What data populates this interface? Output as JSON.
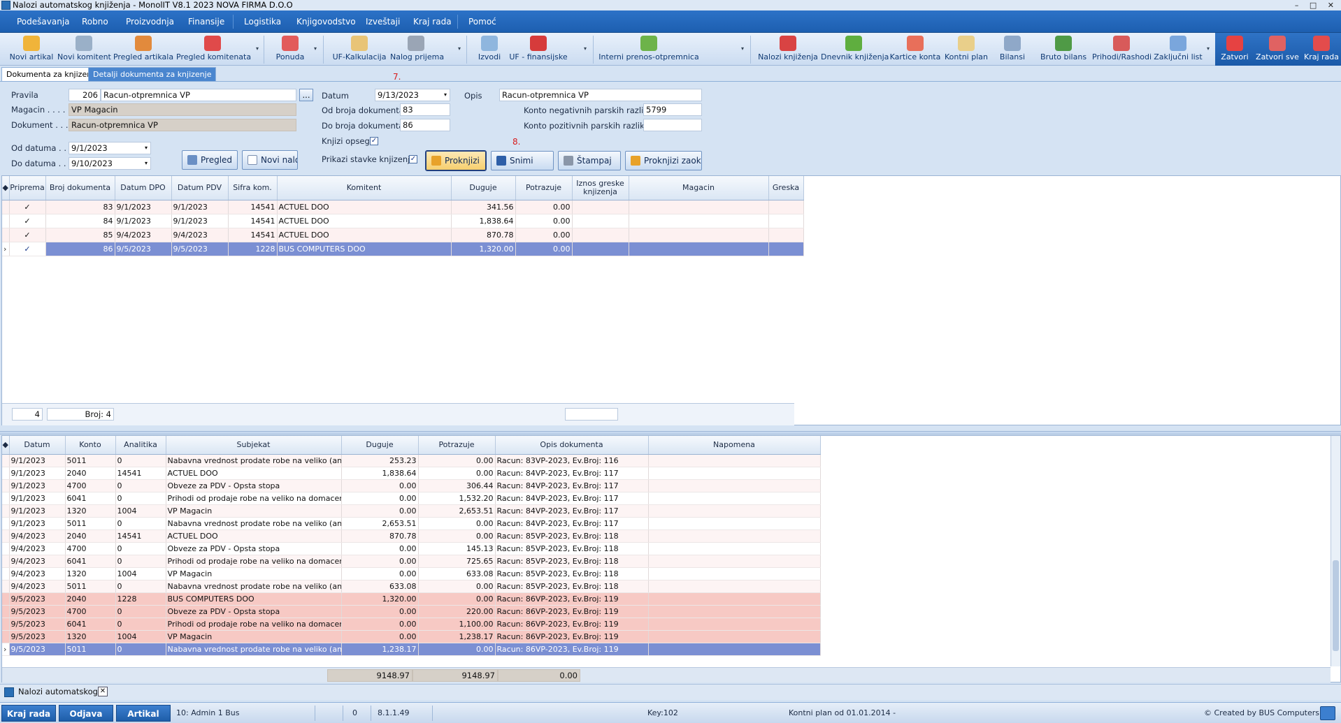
{
  "window": {
    "title": "Nalozi automatskog knjiženja - MonolIT V8.1 2023 NOVA FIRMA D.O.O",
    "controls": "– □ ✕"
  },
  "menu": [
    "Podešavanja",
    "Robno",
    "Proizvodnja",
    "Finansije",
    "Logistika",
    "Knjigovodstvo",
    "Izveštaji",
    "Kraj rada",
    "Pomoć"
  ],
  "ribbon": {
    "left": [
      {
        "label": "Novi artikal",
        "color": "#f0b43a"
      },
      {
        "label": "Novi komitent",
        "color": "#9ab0c8"
      },
      {
        "label": "Pregled artikala",
        "color": "#e28a3c"
      },
      {
        "label": "Pregled komitenata",
        "color": "#e04a4a"
      },
      {
        "label": "Ponuda",
        "color": "#e25b5b"
      },
      {
        "label": "UF-Kalkulacija",
        "color": "#e8c477"
      },
      {
        "label": "Nalog prijema",
        "color": "#9aa5b5"
      },
      {
        "label": "Izvodi",
        "color": "#8fb6de"
      },
      {
        "label": "UF - finansijske",
        "color": "#d63b3b"
      },
      {
        "label": "Interni prenos-otpremnica",
        "color": "#6db34a"
      },
      {
        "label": "Nalozi knjiženja",
        "color": "#d94343"
      },
      {
        "label": "Dnevnik knjiženja",
        "color": "#5fae3f"
      },
      {
        "label": "Kartice konta",
        "color": "#e86f5a"
      },
      {
        "label": "Kontni plan",
        "color": "#e9cf8a"
      },
      {
        "label": "Bilansi",
        "color": "#8fa8c8"
      },
      {
        "label": "Bruto bilans",
        "color": "#4f9a46"
      },
      {
        "label": "Prihodi/Rashodi",
        "color": "#d85a5a"
      },
      {
        "label": "Zaključni list",
        "color": "#7aa6dc"
      }
    ],
    "right": [
      {
        "label": "Zatvori",
        "color": "#e64242"
      },
      {
        "label": "Zatvori sve",
        "color": "#e06262"
      },
      {
        "label": "Kraj rada",
        "color": "#e34c4c"
      }
    ]
  },
  "tabs": [
    "Dokumenta za knjizenje",
    "Detalji dokumenta za knjizenje"
  ],
  "form": {
    "pravila_label": "Pravila",
    "pravila_code": "206",
    "pravila_name": "Racun-otpremnica VP",
    "dots": "...",
    "magacin_label": "Magacin . . . . .",
    "magacin_value": "VP Magacin",
    "dokument_label": "Dokument . . .",
    "dokument_value": "Racun-otpremnica VP",
    "od_datuma_label": "Od datuma . . .",
    "od_datuma": "9/1/2023",
    "do_datuma_label": "Do datuma . . . .",
    "do_datuma": "9/10/2023",
    "datum_label": "Datum",
    "datum": "9/13/2023",
    "od_broja_label": "Od broja dokumenta",
    "od_broja": "83",
    "do_broja_label": "Do broja dokumenta",
    "do_broja": "86",
    "knjizi_opseg_label": "Knjizi opseg",
    "prikazi_label": "Prikazi stavke knjizenja",
    "opis_label": "Opis",
    "opis": "Racun-otpremnica VP",
    "konto_neg_label": "Konto negativnih parskih razlika",
    "konto_neg": "5799",
    "konto_poz_label": "Konto pozitivnih parskih razlika",
    "konto_poz": "",
    "marker7": "7.",
    "marker8": "8."
  },
  "buttons": {
    "pregled": "Pregled",
    "novi_nalog": "Novi nalog",
    "proknjizi": "Proknjizi",
    "snimi": "Snimi",
    "stampaj": "Štampaj",
    "proknjizi_zak": "Proknjizi zaokruživanje"
  },
  "grid1": {
    "headers": [
      "Priprema",
      "Broj dokumenta",
      "Datum DPO",
      "Datum PDV",
      "Sifra kom.",
      "Komitent",
      "Duguje",
      "Potrazuje",
      "Iznos greske knjizenja",
      "Magacin",
      "Greska"
    ],
    "rows": [
      {
        "checked": "✓",
        "broj": "83",
        "dpo": "9/1/2023",
        "pdv": "9/1/2023",
        "sifra": "14541",
        "komitent": "ACTUEL DOO",
        "duguje": "341.56",
        "potrazuje": "0.00"
      },
      {
        "checked": "✓",
        "broj": "84",
        "dpo": "9/1/2023",
        "pdv": "9/1/2023",
        "sifra": "14541",
        "komitent": "ACTUEL DOO",
        "duguje": "1,838.64",
        "potrazuje": "0.00"
      },
      {
        "checked": "✓",
        "broj": "85",
        "dpo": "9/4/2023",
        "pdv": "9/4/2023",
        "sifra": "14541",
        "komitent": "ACTUEL DOO",
        "duguje": "870.78",
        "potrazuje": "0.00"
      },
      {
        "checked": "✓",
        "broj": "86",
        "dpo": "9/5/2023",
        "pdv": "9/5/2023",
        "sifra": "1228",
        "komitent": "BUS COMPUTERS DOO",
        "duguje": "1,320.00",
        "potrazuje": "0.00"
      }
    ],
    "footer_count": "4",
    "footer_broj": "Broj: 4"
  },
  "grid2": {
    "headers": [
      "Datum",
      "Konto",
      "Analitika",
      "Subjekat",
      "Duguje",
      "Potrazuje",
      "Opis dokumenta",
      "Napomena"
    ],
    "rows": [
      {
        "datum": "9/1/2023",
        "konto": "5011",
        "analitika": "0",
        "subjekat": "Nabavna vrednost prodate robe na veliko (analitika",
        "duguje": "253.23",
        "potrazuje": "0.00",
        "opis": "Racun: 83VP-2023, Ev.Broj: 116"
      },
      {
        "datum": "9/1/2023",
        "konto": "2040",
        "analitika": "14541",
        "subjekat": "ACTUEL DOO",
        "duguje": "1,838.64",
        "potrazuje": "0.00",
        "opis": "Racun: 84VP-2023, Ev.Broj: 117"
      },
      {
        "datum": "9/1/2023",
        "konto": "4700",
        "analitika": "0",
        "subjekat": "Obveze za PDV - Opsta stopa",
        "duguje": "0.00",
        "potrazuje": "306.44",
        "opis": "Racun: 84VP-2023, Ev.Broj: 117"
      },
      {
        "datum": "9/1/2023",
        "konto": "6041",
        "analitika": "0",
        "subjekat": "Prihodi od prodaje robe na veliko na domacem trzist",
        "duguje": "0.00",
        "potrazuje": "1,532.20",
        "opis": "Racun: 84VP-2023, Ev.Broj: 117"
      },
      {
        "datum": "9/1/2023",
        "konto": "1320",
        "analitika": "1004",
        "subjekat": "VP Magacin",
        "duguje": "0.00",
        "potrazuje": "2,653.51",
        "opis": "Racun: 84VP-2023, Ev.Broj: 117"
      },
      {
        "datum": "9/1/2023",
        "konto": "5011",
        "analitika": "0",
        "subjekat": "Nabavna vrednost prodate robe na veliko (analitika",
        "duguje": "2,653.51",
        "potrazuje": "0.00",
        "opis": "Racun: 84VP-2023, Ev.Broj: 117"
      },
      {
        "datum": "9/4/2023",
        "konto": "2040",
        "analitika": "14541",
        "subjekat": "ACTUEL DOO",
        "duguje": "870.78",
        "potrazuje": "0.00",
        "opis": "Racun: 85VP-2023, Ev.Broj: 118"
      },
      {
        "datum": "9/4/2023",
        "konto": "4700",
        "analitika": "0",
        "subjekat": "Obveze za PDV - Opsta stopa",
        "duguje": "0.00",
        "potrazuje": "145.13",
        "opis": "Racun: 85VP-2023, Ev.Broj: 118"
      },
      {
        "datum": "9/4/2023",
        "konto": "6041",
        "analitika": "0",
        "subjekat": "Prihodi od prodaje robe na veliko na domacem trzist",
        "duguje": "0.00",
        "potrazuje": "725.65",
        "opis": "Racun: 85VP-2023, Ev.Broj: 118"
      },
      {
        "datum": "9/4/2023",
        "konto": "1320",
        "analitika": "1004",
        "subjekat": "VP Magacin",
        "duguje": "0.00",
        "potrazuje": "633.08",
        "opis": "Racun: 85VP-2023, Ev.Broj: 118"
      },
      {
        "datum": "9/4/2023",
        "konto": "5011",
        "analitika": "0",
        "subjekat": "Nabavna vrednost prodate robe na veliko (analitika",
        "duguje": "633.08",
        "potrazuje": "0.00",
        "opis": "Racun: 85VP-2023, Ev.Broj: 118"
      },
      {
        "datum": "9/5/2023",
        "konto": "2040",
        "analitika": "1228",
        "subjekat": "BUS COMPUTERS DOO",
        "duguje": "1,320.00",
        "potrazuje": "0.00",
        "opis": "Racun: 86VP-2023, Ev.Broj: 119"
      },
      {
        "datum": "9/5/2023",
        "konto": "4700",
        "analitika": "0",
        "subjekat": "Obveze za PDV - Opsta stopa",
        "duguje": "0.00",
        "potrazuje": "220.00",
        "opis": "Racun: 86VP-2023, Ev.Broj: 119"
      },
      {
        "datum": "9/5/2023",
        "konto": "6041",
        "analitika": "0",
        "subjekat": "Prihodi od prodaje robe na veliko na domacem trzist",
        "duguje": "0.00",
        "potrazuje": "1,100.00",
        "opis": "Racun: 86VP-2023, Ev.Broj: 119"
      },
      {
        "datum": "9/5/2023",
        "konto": "1320",
        "analitika": "1004",
        "subjekat": "VP Magacin",
        "duguje": "0.00",
        "potrazuje": "1,238.17",
        "opis": "Racun: 86VP-2023, Ev.Broj: 119"
      },
      {
        "datum": "9/5/2023",
        "konto": "5011",
        "analitika": "0",
        "subjekat": "Nabavna vrednost prodate robe na veliko (analitika",
        "duguje": "1,238.17",
        "potrazuje": "0.00",
        "opis": "Racun: 86VP-2023, Ev.Broj: 119"
      }
    ],
    "totals": {
      "duguje": "9148.97",
      "potrazuje": "9148.97",
      "razlika": "0.00"
    }
  },
  "doc_tab": "Nalozi automatskog ...",
  "status": {
    "kraj_rada": "Kraj rada",
    "odjava": "Odjava",
    "artikal": "Artikal",
    "user": "10: Admin 1 Bus",
    "num": "0",
    "version": "8.1.1.49",
    "key": "Key:102",
    "kontni": "Kontni plan od 01.01.2014 -",
    "created": "© Created by BUS Computers"
  }
}
